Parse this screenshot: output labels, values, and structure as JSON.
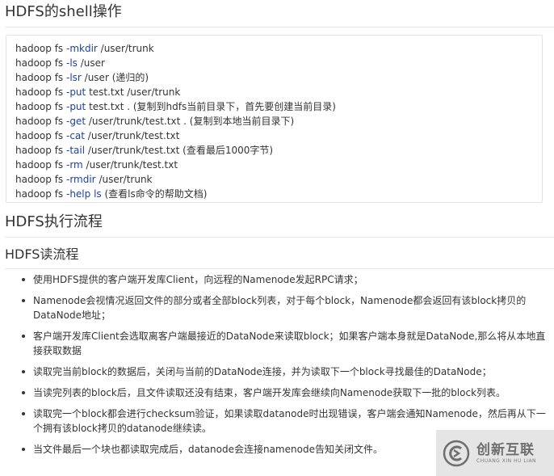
{
  "sections": {
    "shell_title": "HDFS的shell操作",
    "flow_title": "HDFS执行流程",
    "read_title": "HDFS读流程"
  },
  "commands": [
    {
      "pre": "hadoop fs ",
      "kw": "-mkdir",
      "post": " /user/trunk"
    },
    {
      "pre": "hadoop fs ",
      "kw": "-ls",
      "post": " /user"
    },
    {
      "pre": "hadoop fs ",
      "kw": "-lsr",
      "post": " /user   (递归的)"
    },
    {
      "pre": "hadoop fs ",
      "kw": "-put",
      "post": " test.txt /user/trunk"
    },
    {
      "pre": "hadoop fs ",
      "kw": "-put",
      "post": " test.txt .  (复制到hdfs当前目录下，首先要创建当前目录)"
    },
    {
      "pre": "hadoop fs ",
      "kw": "-get",
      "post": " /user/trunk/test.txt . (复制到本地当前目录下)"
    },
    {
      "pre": "hadoop fs ",
      "kw": "-cat",
      "post": " /user/trunk/test.txt"
    },
    {
      "pre": "hadoop fs ",
      "kw": "-tail",
      "post": " /user/trunk/test.txt  (查看最后1000字节)"
    },
    {
      "pre": "hadoop fs ",
      "kw": "-rm",
      "post": " /user/trunk/test.txt"
    },
    {
      "pre": "hadoop fs ",
      "kw": "-rmdir",
      "post": " /user/trunk"
    },
    {
      "pre": "hadoop fs ",
      "kw": "-help ls",
      "post": " (查看ls命令的帮助文档)"
    }
  ],
  "read_steps": [
    "使用HDFS提供的客户端开发库Client，向远程的Namenode发起RPC请求；",
    "Namenode会视情况返回文件的部分或者全部block列表，对于每个block，Namenode都会返回有该block拷贝的DataNode地址；",
    "客户端开发库Client会选取离客户端最接近的DataNode来读取block；如果客户端本身就是DataNode,那么将从本地直接获取数据",
    "读取完当前block的数据后，关闭与当前的DataNode连接，并为读取下一个block寻找最佳的DataNode；",
    "当读完列表的block后，且文件读取还没有结束，客户端开发库会继续向Namenode获取下一批的block列表。",
    "读取完一个block都会进行checksum验证，如果读取datanode时出现错误，客户端会通知Namenode，然后再从下一个拥有该block拷贝的datanode继续读。",
    "当文件最后一个块也都读取完成后，datanode会连接namenode告知关闭文件。"
  ],
  "watermark": {
    "brand": "创新互联",
    "sub": "CHUANG XIN HU LIAN"
  },
  "colors": {
    "command_keyword": "#1a3fa6",
    "text": "#333333"
  }
}
